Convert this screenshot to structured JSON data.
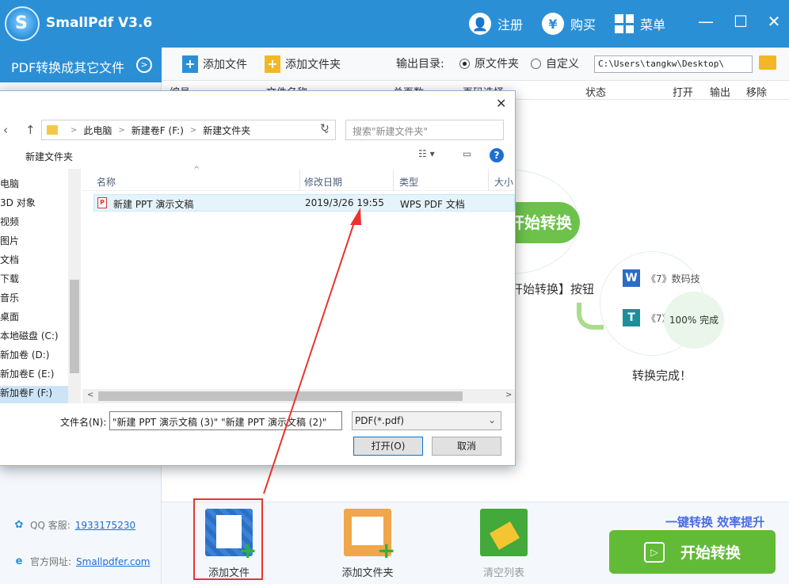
{
  "app": {
    "title": "SmallPdf V3.6",
    "logo_letter": "S"
  },
  "titlebar": {
    "register_label": "注册",
    "buy_label": "购买",
    "buy_icon_glyph": "¥",
    "menu_label": "菜单",
    "minimize": "—",
    "maximize": "☐",
    "close": "✕"
  },
  "sidebar": {
    "header_label": "PDF转换成其它文件",
    "qq_label": "QQ 客服:",
    "qq_number": "1933175230",
    "site_label": "官方网址:",
    "site_url": "Smallpdfer.com"
  },
  "toolbar": {
    "add_file": "添加文件",
    "add_folder": "添加文件夹",
    "output_dir_label": "输出目录:",
    "radio_original": "原文件夹",
    "radio_custom": "自定义",
    "path_value": "C:\\Users\\tangkw\\Desktop\\"
  },
  "table_header": {
    "col_no": "编号",
    "col_name": "文件名称",
    "col_pages": "总页数",
    "col_range": "页码选择",
    "col_status": "状态",
    "col_open": "打开",
    "col_output": "输出",
    "col_remove": "移除"
  },
  "illustration": {
    "start_label": "开始转换",
    "hint": "开始转换】按钮",
    "row1_text": "《7》数码技",
    "row2_text": "《7》",
    "row1_icon": "W",
    "row2_icon": "T",
    "percent": "100%",
    "percent_done": "完成",
    "done_text": "转换完成！"
  },
  "bottom": {
    "add_file": "添加文件",
    "add_folder": "添加文件夹",
    "clear_list": "清空列表",
    "slogan": "一键转换  效率提升",
    "start_button": "开始转换"
  },
  "dialog": {
    "close": "✕",
    "breadcrumb": [
      "此电脑",
      "新建卷F (F:)",
      "新建文件夹"
    ],
    "search_placeholder": "搜索\"新建文件夹\"",
    "toolbar_new_folder": "新建文件夹",
    "nav_items": [
      "电脑",
      "3D 对象",
      "视频",
      "图片",
      "文档",
      "下载",
      "音乐",
      "桌面",
      "本地磁盘 (C:)",
      "新加卷 (D:)",
      "新加卷E (E:)",
      "新加卷F (F:)"
    ],
    "columns": {
      "name": "名称",
      "modified": "修改日期",
      "type": "类型",
      "size": "大小"
    },
    "file": {
      "name": "新建 PPT 演示文稿",
      "modified": "2019/3/26 19:55",
      "type": "WPS PDF 文档"
    },
    "filename_label": "文件名(N):",
    "filename_value": "\"新建 PPT 演示文稿 (3)\" \"新建 PPT 演示文稿 (2)\"",
    "filetype_value": "PDF(*.pdf)",
    "open_button": "打开(O)",
    "cancel_button": "取消"
  },
  "colors": {
    "brand_blue": "#2b8fd6",
    "green": "#62bb36",
    "highlight_red": "#e8352f"
  }
}
